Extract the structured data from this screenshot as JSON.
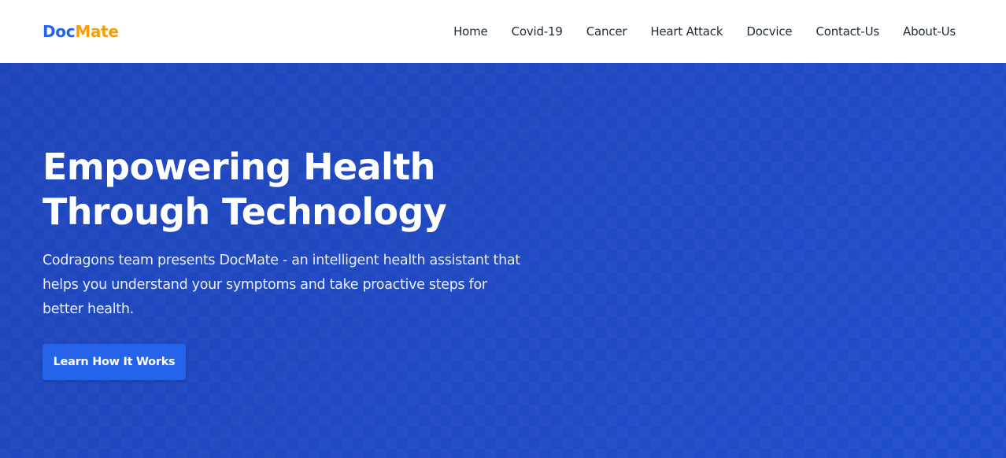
{
  "brand": {
    "part1": "Doc",
    "part2": "Mate",
    "color1": "#2563eb",
    "color2": "#f59e0b"
  },
  "nav": {
    "items": [
      {
        "label": "Home"
      },
      {
        "label": "Covid-19"
      },
      {
        "label": "Cancer"
      },
      {
        "label": "Heart Attack"
      },
      {
        "label": "Docvice"
      },
      {
        "label": "Contact-Us"
      },
      {
        "label": "About-Us"
      }
    ]
  },
  "hero": {
    "title_line1": "Empowering Health",
    "title_line2": "Through Technology",
    "description": "Codragons team presents DocMate - an intelligent health assistant that helps you understand your symptoms and take proactive steps for better health.",
    "cta_label": "Learn How It Works",
    "background_color": "#1f47c0",
    "button_color": "#2563eb"
  }
}
